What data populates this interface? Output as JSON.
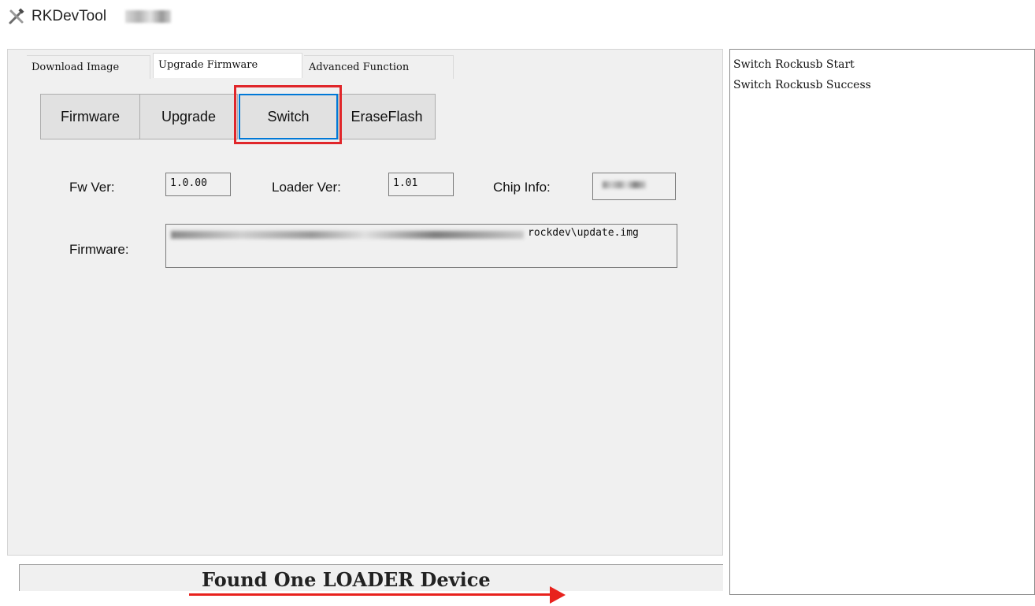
{
  "window": {
    "title": "RKDevTool",
    "icon": "tools-icon"
  },
  "tabs": [
    {
      "label": "Download Image",
      "active": false
    },
    {
      "label": "Upgrade Firmware",
      "active": true
    },
    {
      "label": "Advanced Function",
      "active": false
    }
  ],
  "buttons": {
    "firmware": "Firmware",
    "upgrade": "Upgrade",
    "switch": "Switch",
    "erase_flash": "EraseFlash"
  },
  "info": {
    "fw_ver_label": "Fw Ver:",
    "fw_ver_value": "1.0.00",
    "loader_ver_label": "Loader Ver:",
    "loader_ver_value": "1.01",
    "chip_info_label": "Chip Info:",
    "firmware_label": "Firmware:",
    "firmware_path_visible": "rockdev\\update.img"
  },
  "status": {
    "text": "Found One LOADER Device"
  },
  "log": {
    "lines": [
      "Switch Rockusb Start",
      "Switch Rockusb Success"
    ]
  },
  "colors": {
    "highlight": "#e0262a",
    "focus": "#0078d7",
    "arrow": "#e8221d"
  }
}
